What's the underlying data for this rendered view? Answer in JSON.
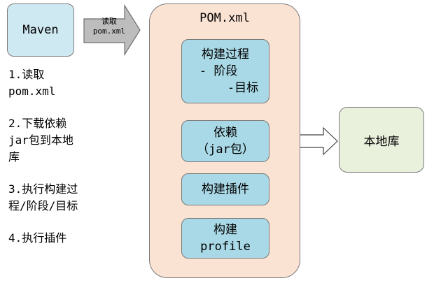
{
  "maven": "Maven",
  "pom_title": "POM.xml",
  "arrow_label": [
    "读取",
    "pom.xml"
  ],
  "boxes": {
    "build_process": [
      "构建过程",
      "- 阶段",
      "-目标"
    ],
    "dependency": [
      "依赖",
      "（jar包）"
    ],
    "build_plugin": "构建插件",
    "build_profile": [
      "构建",
      "profile"
    ]
  },
  "local_repo": "本地库",
  "steps": [
    "1.读取\npom.xml",
    "2.下载依赖\njar包到本地\n库",
    "3.执行构建过\n程/阶段/目标",
    "4.执行插件"
  ]
}
